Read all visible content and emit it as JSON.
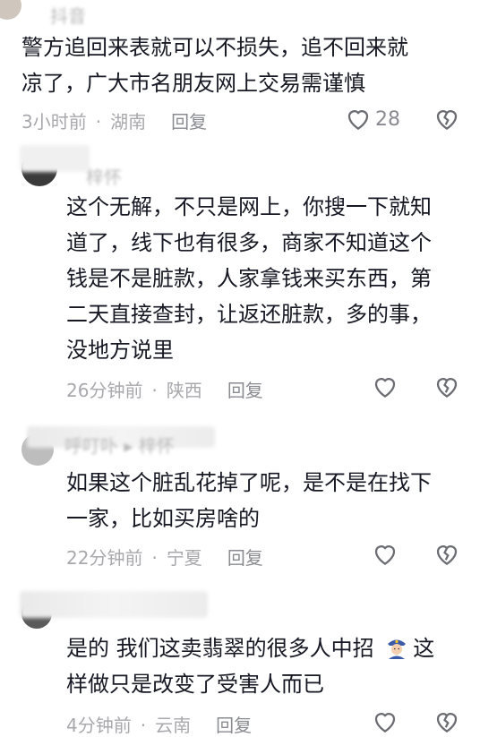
{
  "comments": [
    {
      "username": "抖音",
      "text_lines": [
        "警方追回来表就可以不损失，追不回来就",
        "凉了，广大市名朋友网上交易需谨慎"
      ],
      "time": "3小时前",
      "location": "湖南",
      "reply_label": "回复",
      "like_count": "28"
    },
    {
      "username": "梓怀",
      "text_lines": [
        "这个无解，不只是网上，你搜一下就知",
        "道了，线下也有很多，商家不知道这个",
        "钱是不是脏款，人家拿钱来买东西，第",
        "二天直接查封，让返还脏款，多的事，",
        "没地方说里"
      ],
      "time": "26分钟前",
      "location": "陕西",
      "reply_label": "回复",
      "like_count": ""
    },
    {
      "username": "呼叮卟 ▸ 梓怀",
      "text_lines": [
        "如果这个脏乱花掉了呢，是不是在找下",
        "一家，比如买房啥的"
      ],
      "time": "22分钟前",
      "location": "宁夏",
      "reply_label": "回复",
      "like_count": ""
    },
    {
      "username": "",
      "text_lines": [
        "是的 我们这卖翡翠的很多人中招",
        "样做只是改变了受害人而已"
      ],
      "emoji_after_line0": "police-officer-emoji",
      "line0_suffix": "这",
      "time": "4分钟前",
      "location": "云南",
      "reply_label": "回复",
      "like_count": ""
    }
  ],
  "icons": {
    "like": "heart-outline-icon",
    "dislike": "broken-heart-icon"
  },
  "colors": {
    "text": "#161823",
    "meta": "#a8a8ad",
    "icon": "#6b6c72"
  }
}
